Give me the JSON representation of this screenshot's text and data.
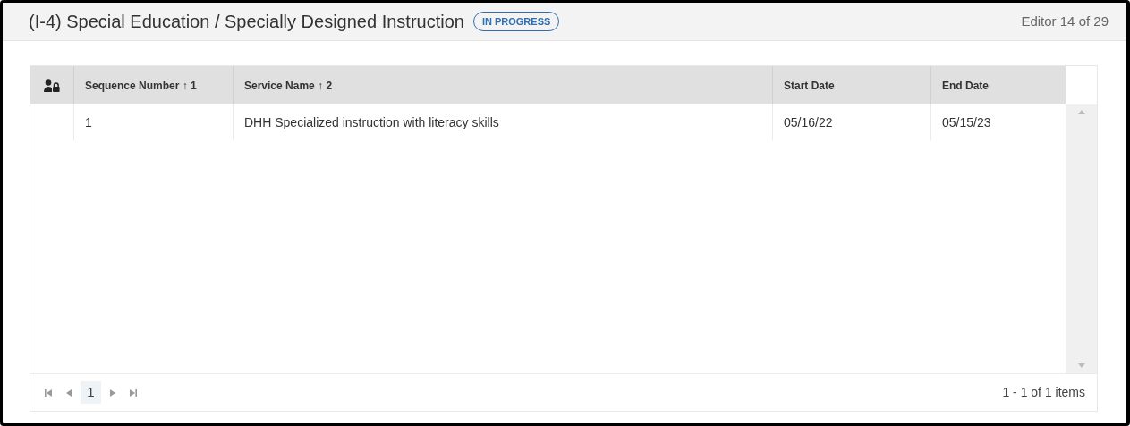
{
  "header": {
    "title": "(I-4) Special Education / Specially Designed Instruction",
    "status": "IN PROGRESS",
    "position": "Editor 14 of 29"
  },
  "table": {
    "columns": [
      {
        "label": "Sequence Number ↑ 1"
      },
      {
        "label": "Service Name ↑ 2"
      },
      {
        "label": "Start Date"
      },
      {
        "label": "End Date"
      }
    ],
    "rows": [
      [
        "1",
        "DHH Specialized instruction with literacy skills",
        "05/16/22",
        "05/15/23"
      ]
    ]
  },
  "pager": {
    "pages": [
      {
        "label": "1",
        "selected": true
      }
    ],
    "summary": "1 - 1 of 1 items"
  }
}
